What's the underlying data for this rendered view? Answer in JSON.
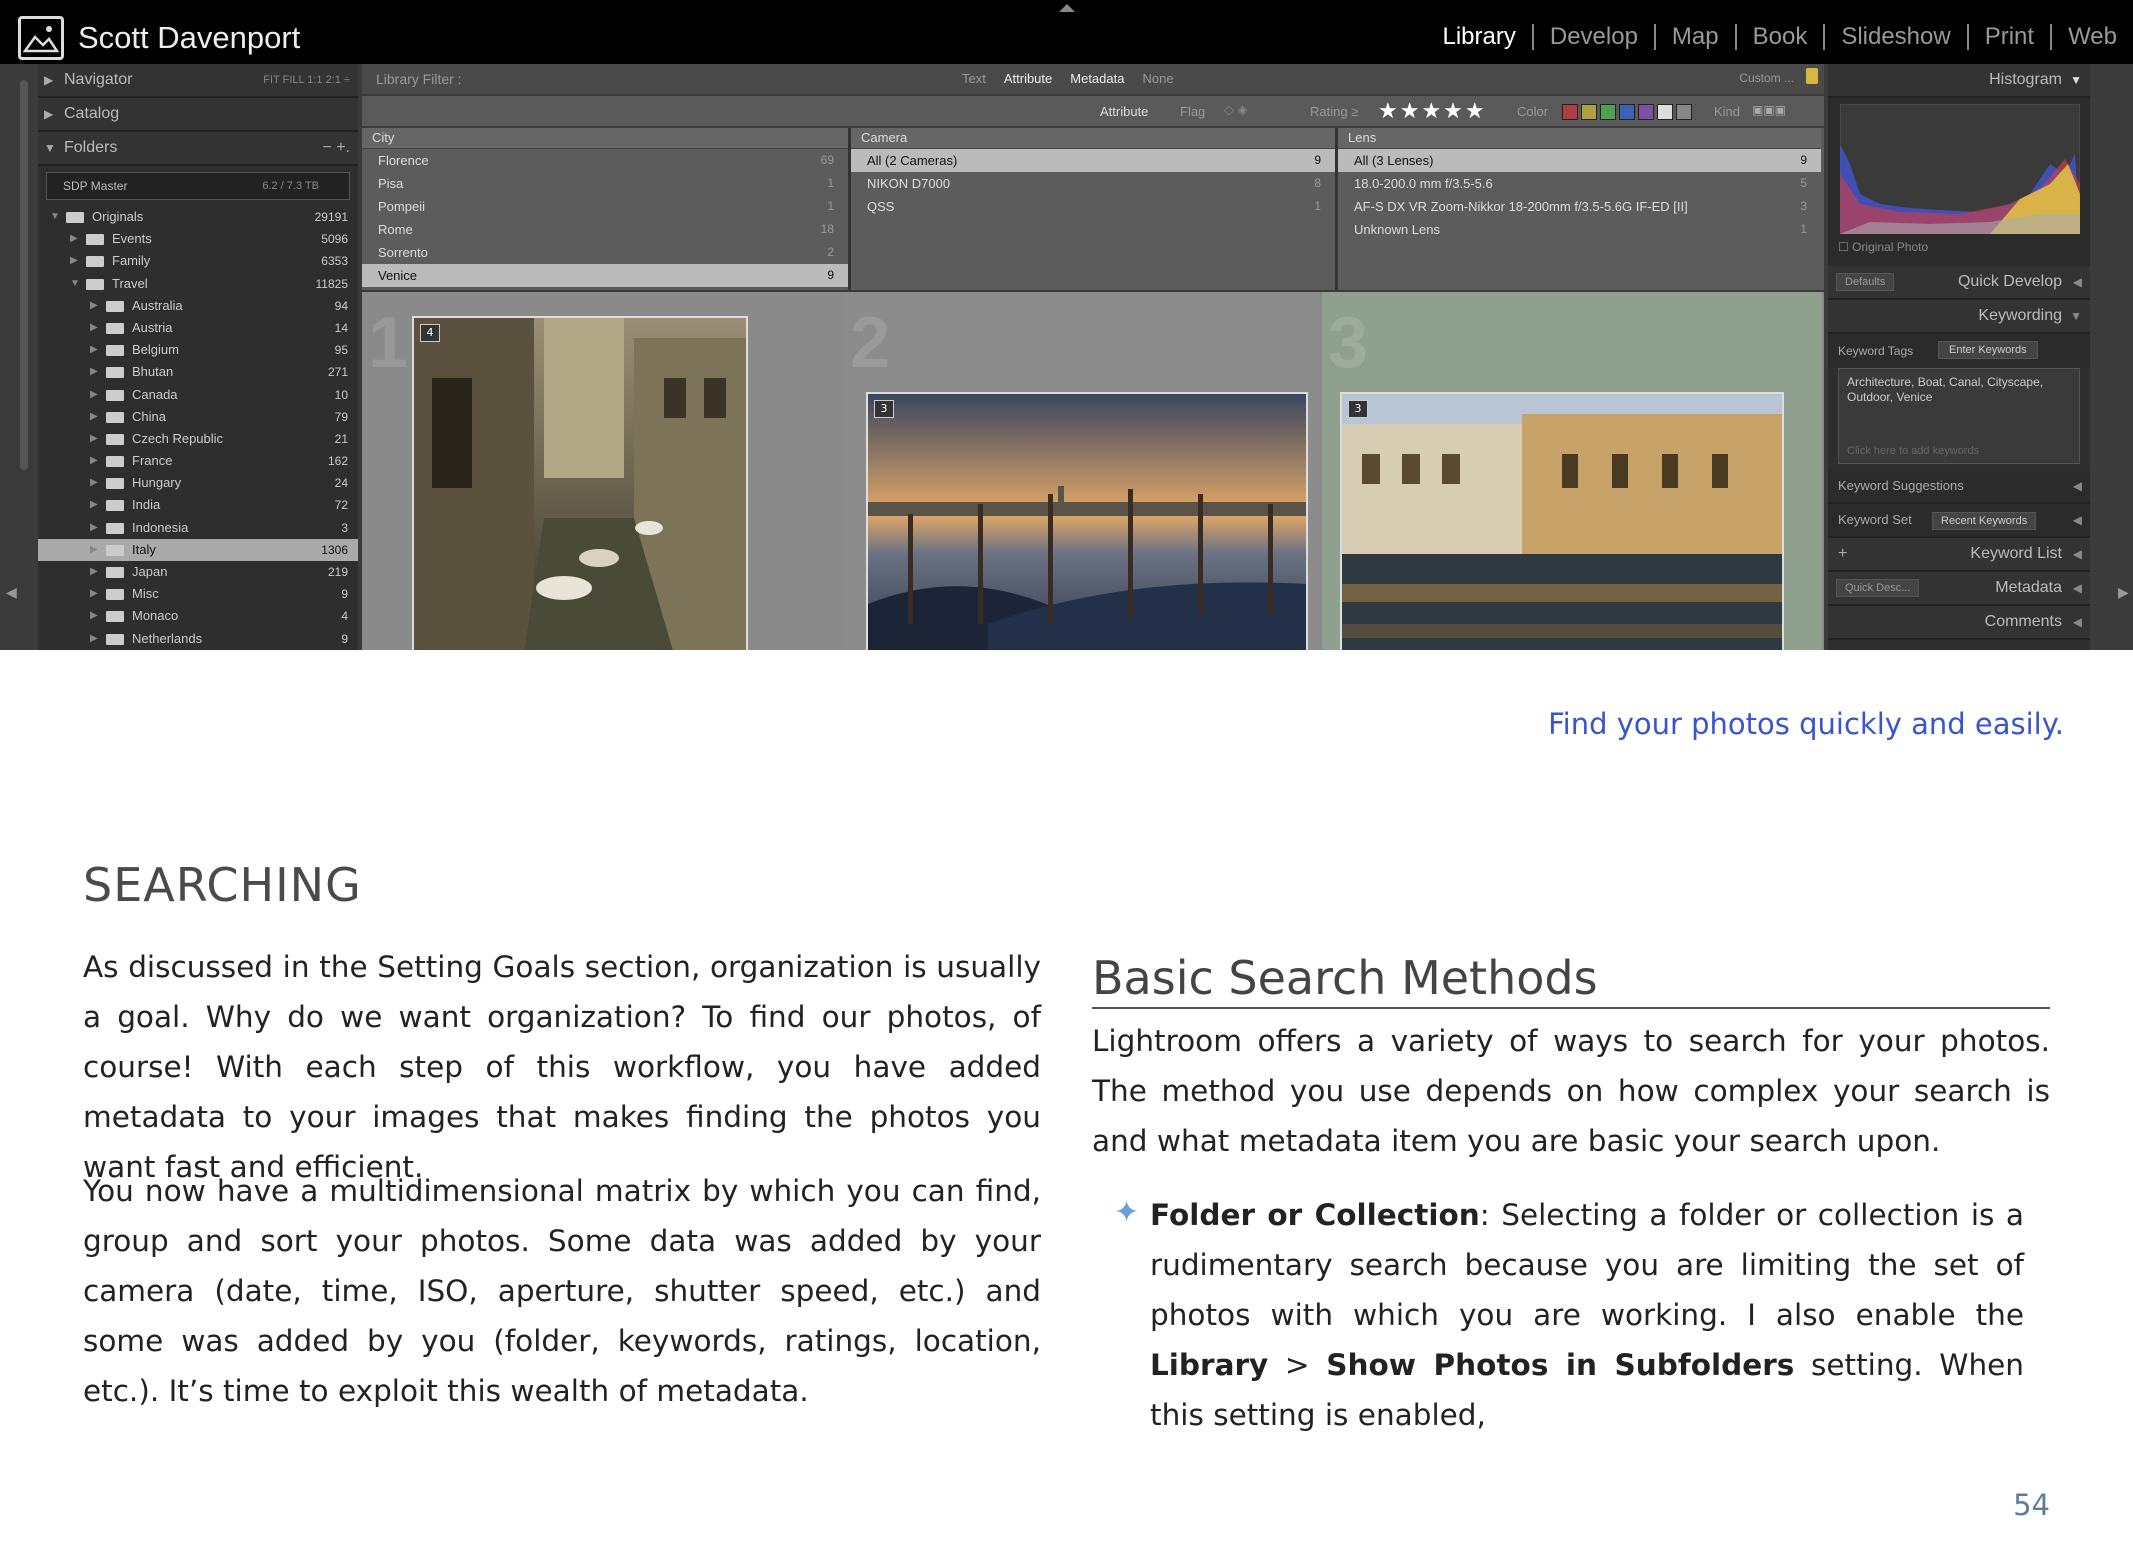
{
  "lightroom": {
    "owner": "Scott Davenport",
    "modules": [
      "Library",
      "Develop",
      "Map",
      "Book",
      "Slideshow",
      "Print",
      "Web"
    ],
    "active_module": "Library",
    "left_panel": {
      "navigator": "Navigator",
      "navigator_zoom": "FIT  FILL  1:1  2:1 ÷",
      "catalog": "Catalog",
      "folders": "Folders",
      "folders_controls": "−  +.",
      "volume": {
        "name": "SDP Master",
        "size": "6.2 / 7.3 TB"
      },
      "folders_list": [
        {
          "name": "Originals",
          "count": "29191",
          "level": 0,
          "open": true
        },
        {
          "name": "Events",
          "count": "5096",
          "level": 1,
          "open": false
        },
        {
          "name": "Family",
          "count": "6353",
          "level": 1,
          "open": false
        },
        {
          "name": "Travel",
          "count": "11825",
          "level": 1,
          "open": true
        },
        {
          "name": "Australia",
          "count": "94",
          "level": 2,
          "open": false
        },
        {
          "name": "Austria",
          "count": "14",
          "level": 2,
          "open": false
        },
        {
          "name": "Belgium",
          "count": "95",
          "level": 2,
          "open": false
        },
        {
          "name": "Bhutan",
          "count": "271",
          "level": 2,
          "open": false
        },
        {
          "name": "Canada",
          "count": "10",
          "level": 2,
          "open": false
        },
        {
          "name": "China",
          "count": "79",
          "level": 2,
          "open": false
        },
        {
          "name": "Czech Republic",
          "count": "21",
          "level": 2,
          "open": false
        },
        {
          "name": "France",
          "count": "162",
          "level": 2,
          "open": false
        },
        {
          "name": "Hungary",
          "count": "24",
          "level": 2,
          "open": false
        },
        {
          "name": "India",
          "count": "72",
          "level": 2,
          "open": false
        },
        {
          "name": "Indonesia",
          "count": "3",
          "level": 2,
          "open": false
        },
        {
          "name": "Italy",
          "count": "1306",
          "level": 2,
          "open": false,
          "selected": true
        },
        {
          "name": "Japan",
          "count": "219",
          "level": 2,
          "open": false
        },
        {
          "name": "Misc",
          "count": "9",
          "level": 2,
          "open": false
        },
        {
          "name": "Monaco",
          "count": "4",
          "level": 2,
          "open": false
        },
        {
          "name": "Netherlands",
          "count": "9",
          "level": 2,
          "open": false
        }
      ]
    },
    "filter_bar": {
      "label": "Library Filter :",
      "modes": [
        "Text",
        "Attribute",
        "Metadata",
        "None"
      ],
      "active_modes": [
        "Attribute",
        "Metadata"
      ],
      "custom": "Custom ..."
    },
    "attribute_bar": {
      "attribute": "Attribute",
      "flag": "Flag",
      "rating": "Rating  ≥",
      "stars": "★★★★★",
      "color": "Color",
      "colors": [
        "#b04040",
        "#b0a040",
        "#50a050",
        "#4060b0",
        "#8050a0",
        "#dddddd",
        "#888888"
      ],
      "kind": "Kind"
    },
    "metadata_columns": [
      {
        "header": "City",
        "rows": [
          {
            "label": "Florence",
            "count": "69"
          },
          {
            "label": "Pisa",
            "count": "1"
          },
          {
            "label": "Pompeii",
            "count": "1"
          },
          {
            "label": "Rome",
            "count": "18"
          },
          {
            "label": "Sorrento",
            "count": "2"
          },
          {
            "label": "Venice",
            "count": "9",
            "selected": true
          }
        ]
      },
      {
        "header": "Camera",
        "rows": [
          {
            "label": "All (2 Cameras)",
            "count": "9",
            "selected": true
          },
          {
            "label": "NIKON D7000",
            "count": "8"
          },
          {
            "label": "QSS",
            "count": "1"
          }
        ]
      },
      {
        "header": "Lens",
        "rows": [
          {
            "label": "All (3 Lenses)",
            "count": "9",
            "selected": true
          },
          {
            "label": "18.0-200.0 mm f/3.5-5.6",
            "count": "5"
          },
          {
            "label": "AF-S DX VR Zoom-Nikkor 18-200mm f/3.5-5.6G IF-ED [II]",
            "count": "3"
          },
          {
            "label": "Unknown Lens",
            "count": "1"
          }
        ]
      }
    ],
    "grid": [
      {
        "index": "1",
        "badge": "4"
      },
      {
        "index": "2",
        "badge": "3"
      },
      {
        "index": "3",
        "badge": "3"
      }
    ],
    "right_panel": {
      "histogram": "Histogram",
      "original_photo": "Original Photo",
      "quick_develop": "Quick Develop",
      "quick_develop_preset": "Defaults",
      "keywording": "Keywording",
      "keyword_tags": "Keyword Tags",
      "enter_keywords": "Enter Keywords",
      "keywords": "Architecture, Boat, Canal, Cityscape, Outdoor, Venice",
      "add_keywords_placeholder": "Click here to add keywords",
      "keyword_suggestions": "Keyword Suggestions",
      "keyword_set": "Keyword Set",
      "recent_keywords": "Recent Keywords",
      "keyword_list": "Keyword List",
      "metadata": "Metadata",
      "metadata_preset": "Quick Desc...",
      "comments": "Comments"
    }
  },
  "doc": {
    "caption": "Find your photos quickly and easily.",
    "heading": "SEARCHING",
    "para1": "As discussed in the Setting Goals section, organization is usually a goal. Why do we want organization? To find our photos, of course! With each step of this workflow, you have added metadata to your images that makes finding the photos you want fast and efficient.",
    "para2": "You now have a multidimensional matrix by which you can find, group and sort your photos. Some data was added by your camera (date, time, ISO, aperture, shutter speed, etc.) and some was added by you (folder, keywords, ratings, location, etc.). It’s time to exploit this wealth of metadata.",
    "subheading": "Basic Search Methods",
    "para3": "Lightroom offers a variety of ways to search for your photos. The method you use depends on how complex your search is and what metadata item you are basic your search upon.",
    "bullet": {
      "term": "Folder or Collection",
      "text1": ": Selecting a folder or collection is a rudimentary search because you are limiting the set of photos with which you are working. I also enable the ",
      "menu1": "Library",
      "sep": " > ",
      "menu2": "Show Photos in Subfolders",
      "text2": " setting. When this setting is enabled,"
    },
    "page_number": "54"
  }
}
